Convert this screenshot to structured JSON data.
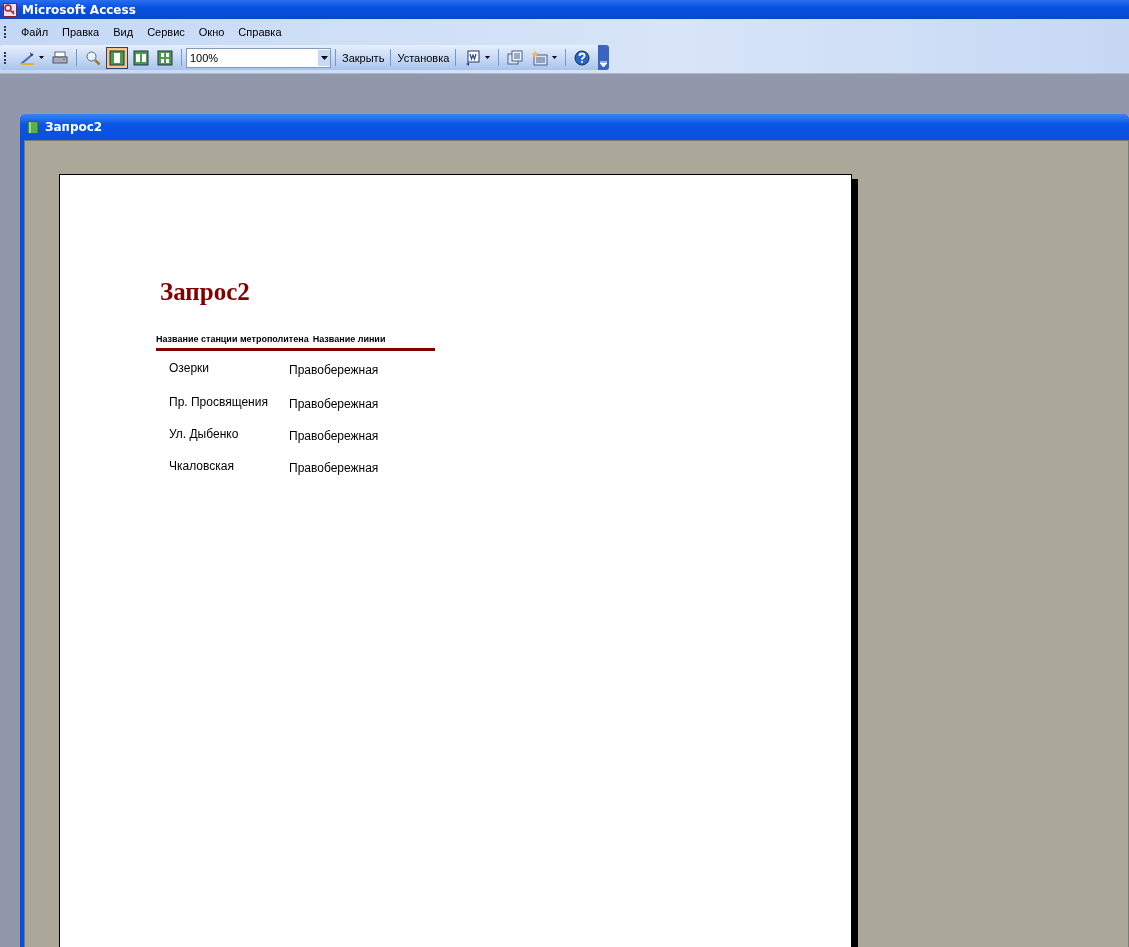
{
  "window": {
    "title": "Microsoft Access"
  },
  "menu": [
    "Файл",
    "Правка",
    "Вид",
    "Сервис",
    "Окно",
    "Справка"
  ],
  "toolbar": {
    "items": [
      {
        "kind": "icon",
        "dropdown": true
      },
      {
        "kind": "icon",
        "dropdown": false
      },
      {
        "kind": "separator"
      },
      {
        "kind": "icon",
        "dropdown": false,
        "selected": false
      },
      {
        "kind": "icon",
        "dropdown": false,
        "selected": true
      },
      {
        "kind": "icon",
        "dropdown": false,
        "selected": false
      },
      {
        "kind": "icon",
        "dropdown": false,
        "selected": false
      },
      {
        "kind": "separator"
      },
      {
        "kind": "combo",
        "value": "100%"
      },
      {
        "kind": "separator"
      },
      {
        "kind": "text",
        "label": "Закрыть"
      },
      {
        "kind": "separator"
      },
      {
        "kind": "text",
        "label": "Установка"
      },
      {
        "kind": "separator"
      },
      {
        "kind": "icon",
        "dropdown": true
      },
      {
        "kind": "separator"
      },
      {
        "kind": "icon",
        "dropdown": false
      },
      {
        "kind": "icon",
        "dropdown": true
      },
      {
        "kind": "separator"
      },
      {
        "kind": "icon",
        "dropdown": false
      }
    ]
  },
  "document_window": {
    "title": "Запрос2",
    "report": {
      "title": "Запрос2",
      "columns": [
        "Название станции метрополитена",
        "Название линии"
      ],
      "rows": [
        {
          "station": "Озерки",
          "line": "Правобережная"
        },
        {
          "station": "Пр. Просвящения",
          "line": "Правобережная"
        },
        {
          "station": "Ул. Дыбенко",
          "line": "Правобережная"
        },
        {
          "station": "Чкаловская",
          "line": "Правобережная"
        }
      ]
    }
  }
}
